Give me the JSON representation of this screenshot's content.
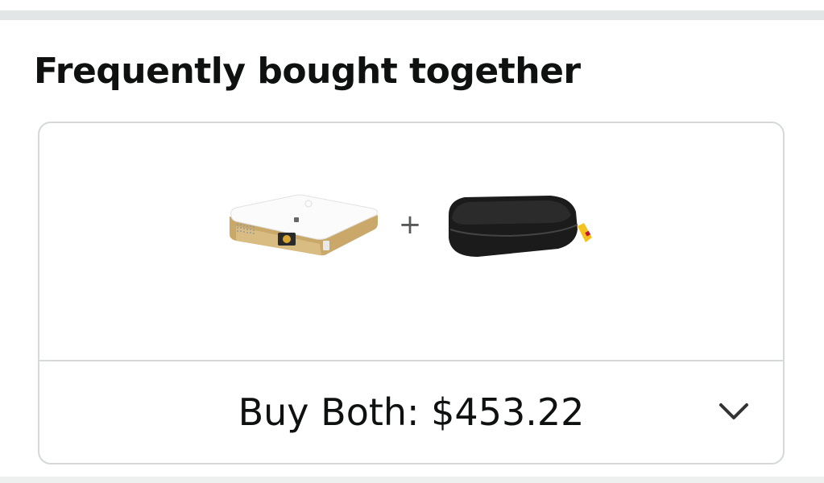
{
  "section": {
    "title": "Frequently bought together"
  },
  "bundle": {
    "products": [
      {
        "icon": "projector-image"
      },
      {
        "icon": "carrying-case-image"
      }
    ],
    "separator": "+",
    "buy_label": "Buy Both: $453.22",
    "expand_icon": "chevron-down-icon"
  },
  "colors": {
    "text": "#0f1111",
    "border": "#d5d9d9",
    "divider": "#e3e6e6",
    "case_tag": "#f5c21b"
  }
}
